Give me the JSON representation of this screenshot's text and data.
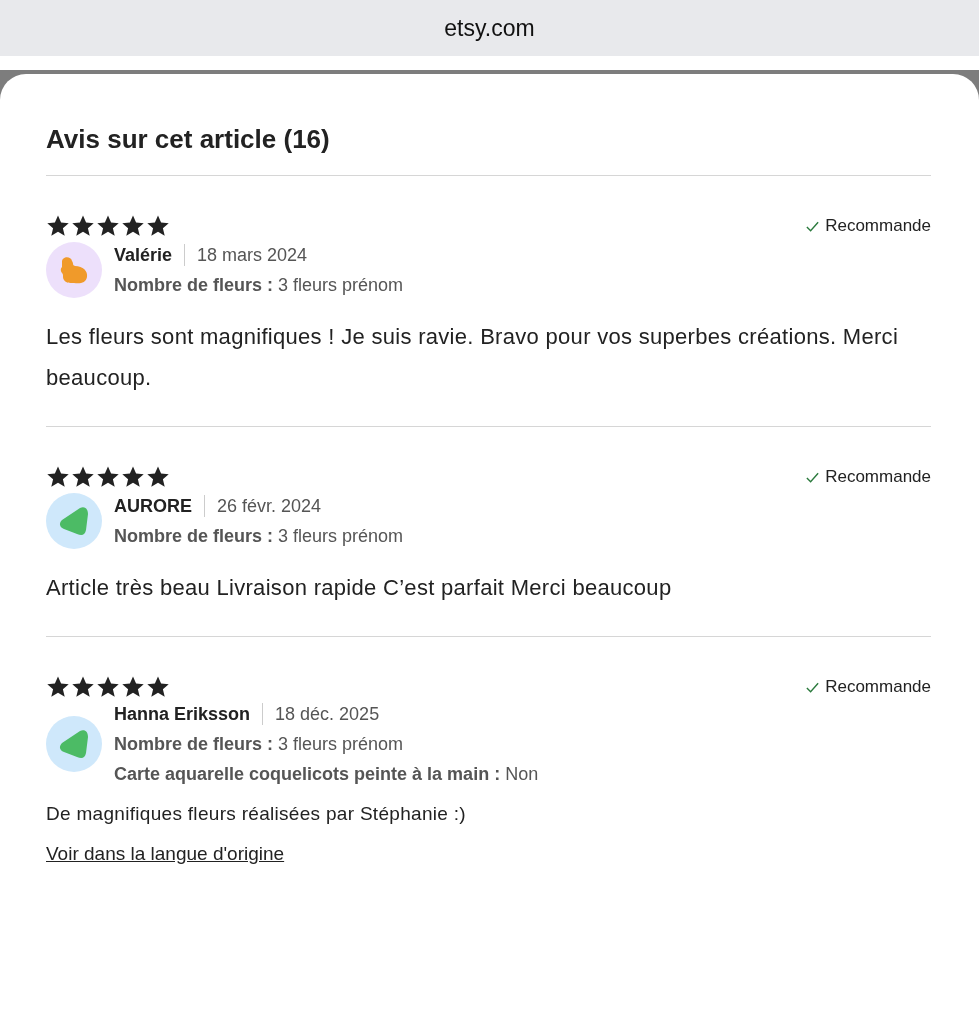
{
  "browser": {
    "address": "etsy.com"
  },
  "reviews_panel": {
    "title": "Avis sur cet article (16)",
    "reviews": [
      {
        "stars": 5,
        "recommended": true,
        "recommend_label": "Recommande",
        "avatar": {
          "kind": "blob"
        },
        "author": "Valérie",
        "date": "18 mars 2024",
        "properties": [
          {
            "label": "Nombre de fleurs :",
            "value": "3 fleurs prénom"
          }
        ],
        "text": "Les fleurs sont magnifiques ! Je suis ravie. Bravo pour vos superbes créations. Merci beaucoup."
      },
      {
        "stars": 5,
        "recommended": true,
        "recommend_label": "Recommande",
        "avatar": {
          "kind": "triangle"
        },
        "author": "AURORE",
        "date": "26 févr. 2024",
        "properties": [
          {
            "label": "Nombre de fleurs :",
            "value": "3 fleurs prénom"
          }
        ],
        "text": "Article très beau Livraison rapide C’est parfait Merci beaucoup"
      },
      {
        "stars": 5,
        "recommended": true,
        "recommend_label": "Recommande",
        "avatar": {
          "kind": "triangle"
        },
        "author": "Hanna Eriksson",
        "date": "18 déc. 2025",
        "properties": [
          {
            "label": "Nombre de fleurs :",
            "value": "3 fleurs prénom"
          },
          {
            "label": "Carte aquarelle coquelicots peinte à la main :",
            "value": "Non"
          }
        ],
        "text": "De magnifiques fleurs réalisées par Stéphanie :)",
        "link": "Voir dans la langue d'origine"
      }
    ]
  }
}
